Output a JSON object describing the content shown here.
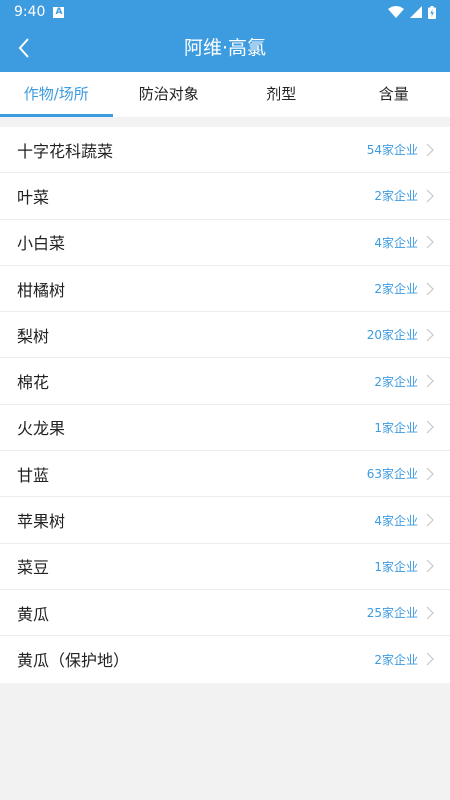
{
  "status_bar": {
    "time": "9:40",
    "notification_glyph": "A"
  },
  "app_bar": {
    "title": "阿维·高氯"
  },
  "tabs": [
    {
      "label": "作物/场所",
      "active": true
    },
    {
      "label": "防治对象",
      "active": false
    },
    {
      "label": "剂型",
      "active": false
    },
    {
      "label": "含量",
      "active": false
    }
  ],
  "list": [
    {
      "name": "十字花科蔬菜",
      "count": "54家企业"
    },
    {
      "name": "叶菜",
      "count": "2家企业"
    },
    {
      "name": "小白菜",
      "count": "4家企业"
    },
    {
      "name": "柑橘树",
      "count": "2家企业"
    },
    {
      "name": "梨树",
      "count": "20家企业"
    },
    {
      "name": "棉花",
      "count": "2家企业"
    },
    {
      "name": "火龙果",
      "count": "1家企业"
    },
    {
      "name": "甘蓝",
      "count": "63家企业"
    },
    {
      "name": "苹果树",
      "count": "4家企业"
    },
    {
      "name": "菜豆",
      "count": "1家企业"
    },
    {
      "name": "黄瓜",
      "count": "25家企业"
    },
    {
      "name": "黄瓜（保护地）",
      "count": "2家企业"
    }
  ],
  "colors": {
    "accent": "#3d9be0",
    "background": "#f2f2f2"
  }
}
